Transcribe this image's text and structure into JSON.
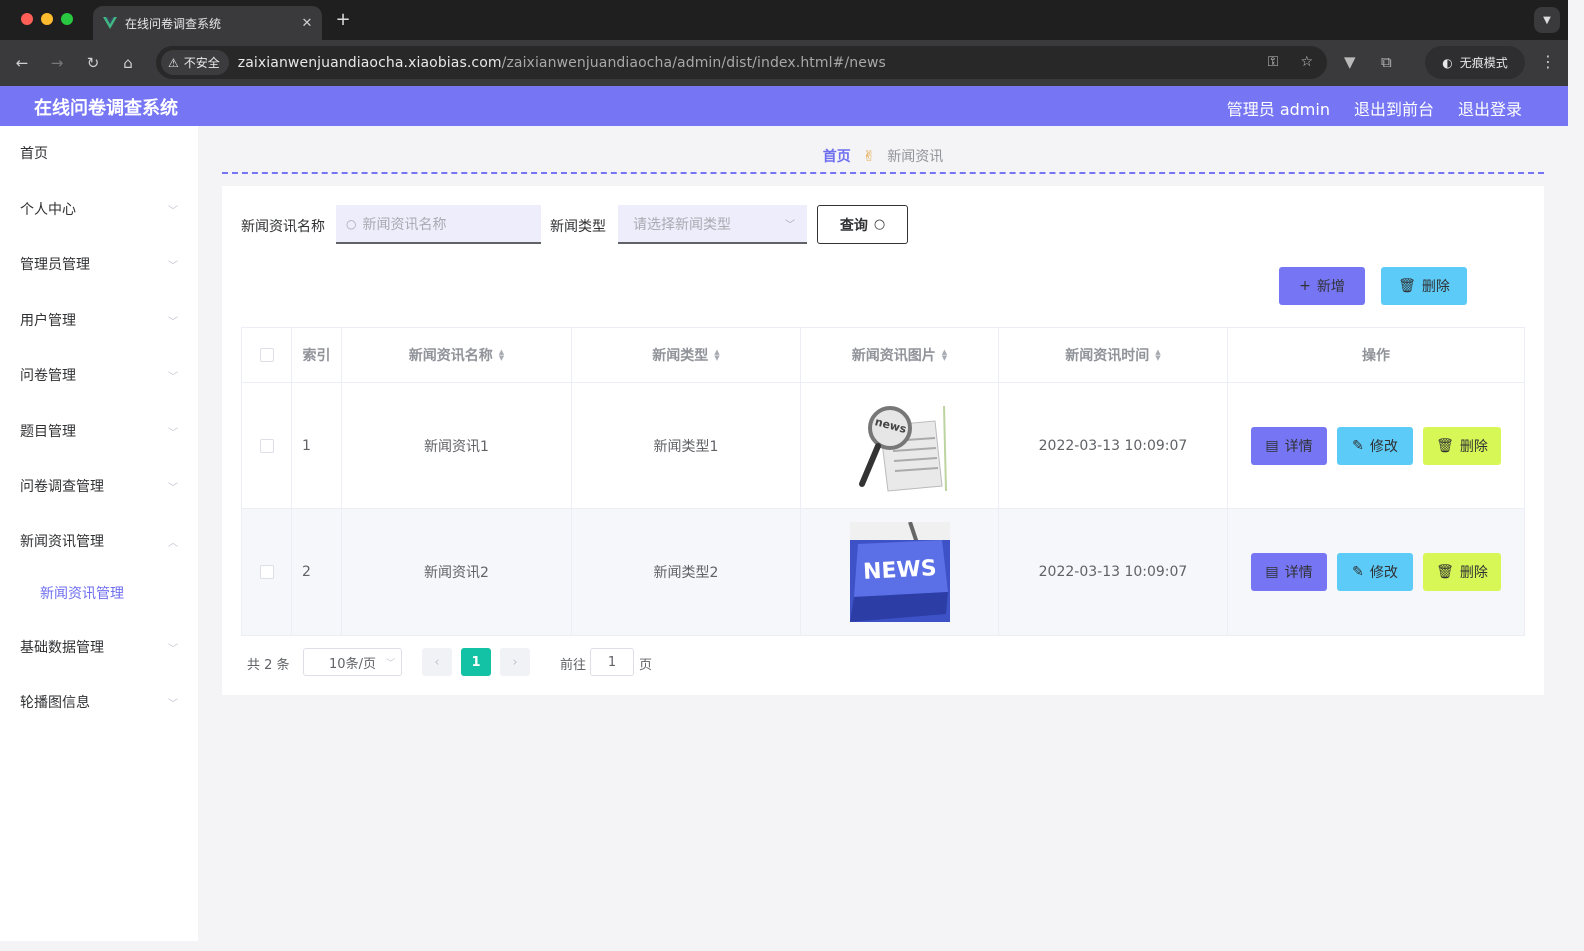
{
  "browser": {
    "tab_title": "在线问卷调查系统",
    "security_label": "不安全",
    "url_host": "zaixianwenjuandiaocha.xiaobias.com",
    "url_path": "/zaixianwenjuandiaocha/admin/dist/index.html#/news",
    "incognito_label": "无痕模式"
  },
  "header": {
    "title": "在线问卷调查系统",
    "admin_label": "管理员 admin",
    "to_front_label": "退出到前台",
    "logout_label": "退出登录",
    "color": "#7676f4"
  },
  "sidebar": {
    "items": [
      {
        "label": "首页"
      },
      {
        "label": "个人中心"
      },
      {
        "label": "管理员管理"
      },
      {
        "label": "用户管理"
      },
      {
        "label": "问卷管理"
      },
      {
        "label": "题目管理"
      },
      {
        "label": "问卷调查管理"
      },
      {
        "label": "新闻资讯管理"
      },
      {
        "label": "基础数据管理"
      },
      {
        "label": "轮播图信息"
      }
    ],
    "active_sub": "新闻资讯管理"
  },
  "breadcrumb": {
    "home": "首页",
    "separator_icon": "victory-hand-icon",
    "current": "新闻资讯"
  },
  "search": {
    "name_label": "新闻资讯名称",
    "name_placeholder": "新闻资讯名称",
    "type_label": "新闻类型",
    "type_placeholder": "请选择新闻类型",
    "query_label": "查询"
  },
  "actions": {
    "add_label": "新增",
    "delete_label": "删除"
  },
  "table": {
    "headers": [
      "索引",
      "新闻资讯名称",
      "新闻类型",
      "新闻资讯图片",
      "新闻资讯时间",
      "操作"
    ],
    "rows": [
      {
        "index": "1",
        "name": "新闻资讯1",
        "type": "新闻类型1",
        "image_text": "news",
        "time": "2022-03-13 10:09:07"
      },
      {
        "index": "2",
        "name": "新闻资讯2",
        "type": "新闻类型2",
        "image_text": "NEWS",
        "time": "2022-03-13 10:09:07"
      }
    ],
    "op_labels": {
      "detail": "详情",
      "edit": "修改",
      "delete": "删除"
    }
  },
  "pagination": {
    "total_text": "共 2 条",
    "page_size": "10条/页",
    "current_page": "1",
    "goto_label": "前往",
    "goto_value": "1",
    "page_suffix": "页"
  },
  "colors": {
    "primary": "#7676f4",
    "info": "#5ccbf7",
    "warn": "#d6f756",
    "page_active": "#13c1a4"
  }
}
